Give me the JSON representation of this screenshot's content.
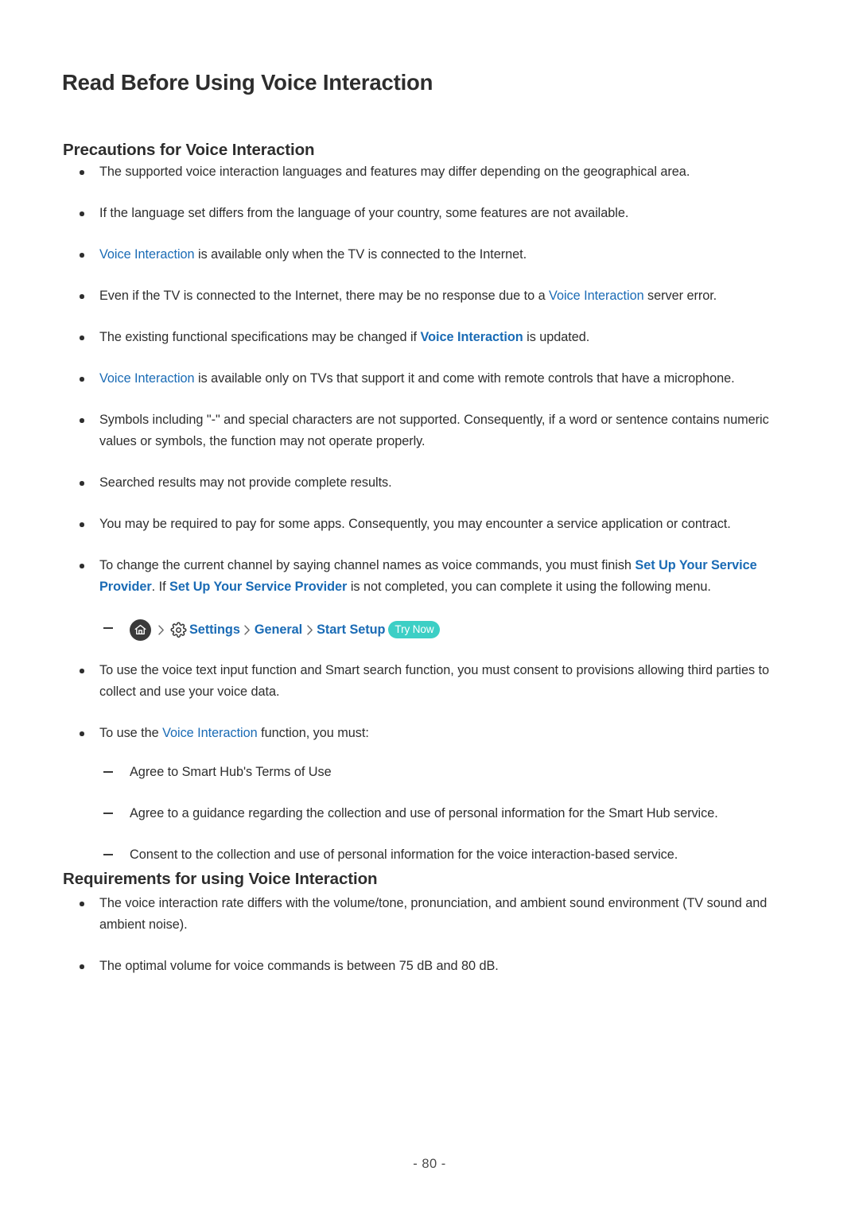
{
  "document": {
    "title": "Read Before Using Voice Interaction",
    "page_number": "- 80 -"
  },
  "link_color": "#1a6bb5",
  "badge_color": "#3ccfc5",
  "sections": {
    "precautions": {
      "heading": "Precautions for Voice Interaction",
      "bullets": {
        "b1": "The supported voice interaction languages and features may differ depending on the geographical area.",
        "b2": "If the language set differs from the language of your country, some features are not available.",
        "b3_link": "Voice Interaction",
        "b3_rest": " is available only when the TV is connected to the Internet.",
        "b4_pre": "Even if the TV is connected to the Internet, there may be no response due to a ",
        "b4_link": "Voice Interaction",
        "b4_post": " server error.",
        "b5_pre": "The existing functional specifications may be changed if ",
        "b5_link": "Voice Interaction",
        "b5_post": " is updated.",
        "b6_link": "Voice Interaction",
        "b6_rest": " is available only on TVs that support it and come with remote controls that have a microphone.",
        "b7": "Symbols including \"-\" and special characters are not supported. Consequently, if a word or sentence contains numeric values or symbols, the function may not operate properly.",
        "b8": "Searched results may not provide complete results.",
        "b9": "You may be required to pay for some apps. Consequently, you may encounter a service application or contract.",
        "b10_pre": "To change the current channel by saying channel names as voice commands, you must finish ",
        "b10_link1": "Set Up Your Service Provider",
        "b10_mid": ". If ",
        "b10_link2": "Set Up Your Service Provider",
        "b10_post": " is not completed, you can complete it using the following menu.",
        "b11": "To use the voice text input function and Smart search function, you must consent to provisions allowing third parties to collect and use your voice data.",
        "b12_pre": "To use the ",
        "b12_link": "Voice Interaction",
        "b12_post": " function, you must:"
      },
      "menu_path": {
        "home_icon": "home-icon",
        "gear_icon": "gear-icon",
        "chevron_icon": "chevron-right-icon",
        "item_settings": "Settings",
        "item_general": "General",
        "item_start_setup": "Start Setup",
        "badge": "Try Now"
      },
      "sub_items": {
        "s1": "Agree to Smart Hub's Terms of Use",
        "s2": "Agree to a guidance regarding the collection and use of personal information for the Smart Hub service.",
        "s3": "Consent to the collection and use of personal information for the voice interaction-based service."
      }
    },
    "requirements": {
      "heading": "Requirements for using Voice Interaction",
      "bullets": {
        "r1": "The voice interaction rate differs with the volume/tone, pronunciation, and ambient sound environment (TV sound and ambient noise).",
        "r2": "The optimal volume for voice commands is between 75 dB and 80 dB."
      }
    }
  }
}
